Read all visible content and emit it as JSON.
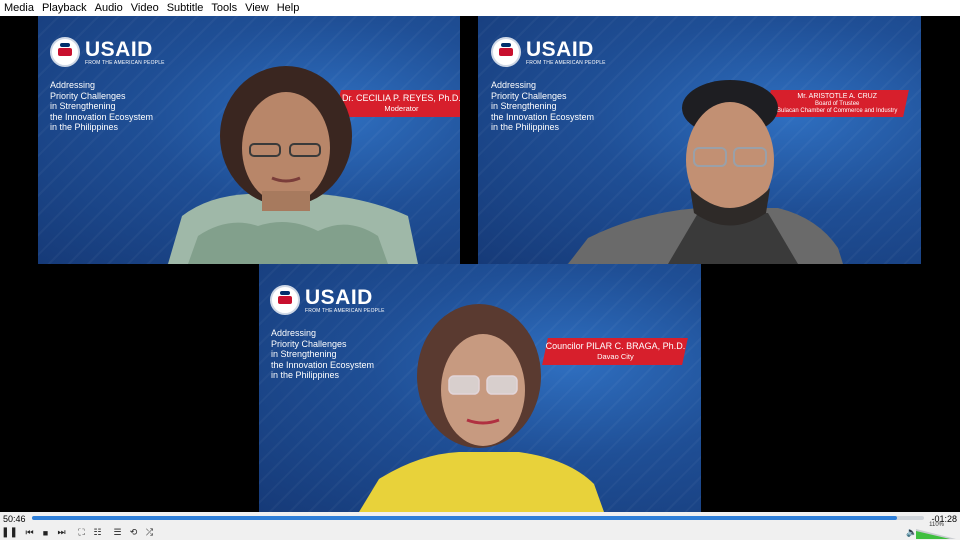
{
  "menu": [
    "Media",
    "Playback",
    "Audio",
    "Video",
    "Subtitle",
    "Tools",
    "View",
    "Help"
  ],
  "logo": {
    "wordmark": "USAID",
    "tagline": "FROM THE AMERICAN PEOPLE"
  },
  "event_title": [
    "Addressing",
    "Priority Challenges",
    "in Strengthening",
    "the Innovation Ecosystem",
    "in the Philippines"
  ],
  "speakers": [
    {
      "name": "Dr. CECILIA P. REYES, Ph.D.",
      "role": "Moderator"
    },
    {
      "name": "Mr. ARISTOTLE A. CRUZ",
      "role": "Board of Trustee",
      "org": "Bulacan Chamber of Commerce and Industry"
    },
    {
      "name": "Councilor PILAR C. BRAGA, Ph.D.",
      "role": "Davao City"
    }
  ],
  "playback": {
    "elapsed": "50:46",
    "remaining": "-01:28",
    "progress": 0.97,
    "volume_label": "110%",
    "volume": 1.1
  },
  "icons": {
    "play": "play-icon",
    "prev": "previous-icon",
    "stop": "stop-icon",
    "next": "next-icon",
    "fullscreen": "fullscreen-icon",
    "extended": "extended-settings-icon",
    "playlist": "playlist-icon",
    "loop": "loop-icon",
    "shuffle": "shuffle-icon",
    "speaker": "speaker-icon"
  },
  "colors": {
    "banner": "#d71f2c",
    "background": "#1f4f96",
    "seek": "#2f7fd8",
    "volume": "#3fbf3f"
  }
}
